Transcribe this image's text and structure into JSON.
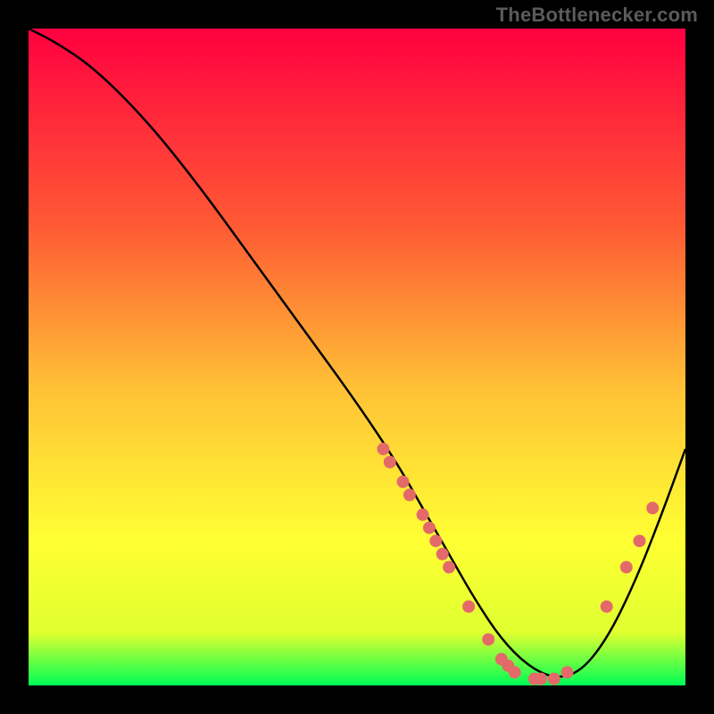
{
  "attribution": "TheBottlenecker.com",
  "chart_data": {
    "type": "line",
    "title": "",
    "xlabel": "",
    "ylabel": "",
    "xlim": [
      0,
      100
    ],
    "ylim": [
      0,
      100
    ],
    "gradient_stops": [
      {
        "offset": 0,
        "color": "#ff0040"
      },
      {
        "offset": 30,
        "color": "#ff5a34"
      },
      {
        "offset": 55,
        "color": "#ffc236"
      },
      {
        "offset": 78,
        "color": "#ffff33"
      },
      {
        "offset": 92,
        "color": "#dfff2f"
      },
      {
        "offset": 100,
        "color": "#00ff55"
      }
    ],
    "series": [
      {
        "name": "bottleneck-curve",
        "x": [
          0,
          4,
          10,
          18,
          26,
          34,
          42,
          50,
          56,
          60,
          64,
          68,
          72,
          76,
          80,
          84,
          88,
          92,
          96,
          100
        ],
        "y": [
          100,
          98,
          94,
          86,
          76,
          65,
          54,
          43,
          34,
          27,
          20,
          13,
          7,
          3,
          1,
          2,
          7,
          15,
          25,
          36
        ]
      }
    ],
    "markers": {
      "name": "data-points",
      "color": "#e46a6a",
      "radius": 7,
      "points": [
        {
          "x": 54,
          "y": 36
        },
        {
          "x": 55,
          "y": 34
        },
        {
          "x": 57,
          "y": 31
        },
        {
          "x": 58,
          "y": 29
        },
        {
          "x": 60,
          "y": 26
        },
        {
          "x": 61,
          "y": 24
        },
        {
          "x": 62,
          "y": 22
        },
        {
          "x": 63,
          "y": 20
        },
        {
          "x": 64,
          "y": 18
        },
        {
          "x": 67,
          "y": 12
        },
        {
          "x": 70,
          "y": 7
        },
        {
          "x": 72,
          "y": 4
        },
        {
          "x": 73,
          "y": 3
        },
        {
          "x": 74,
          "y": 2
        },
        {
          "x": 77,
          "y": 1
        },
        {
          "x": 78,
          "y": 1
        },
        {
          "x": 80,
          "y": 1
        },
        {
          "x": 82,
          "y": 2
        },
        {
          "x": 88,
          "y": 12
        },
        {
          "x": 91,
          "y": 18
        },
        {
          "x": 93,
          "y": 22
        },
        {
          "x": 95,
          "y": 27
        }
      ]
    }
  }
}
